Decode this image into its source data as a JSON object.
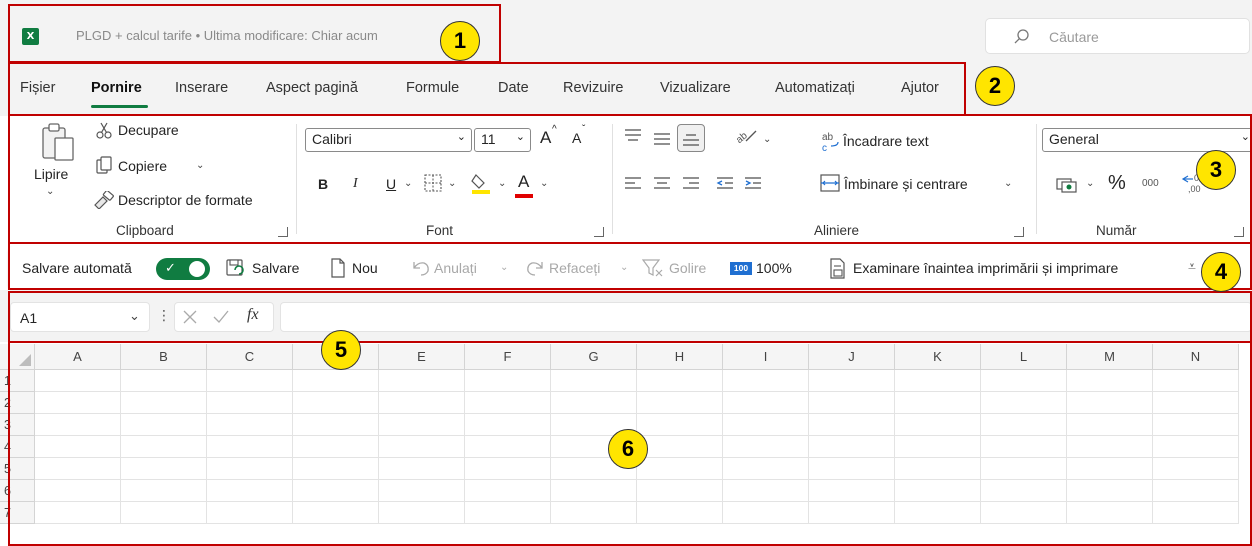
{
  "titlebar": {
    "logo_text": "X",
    "doc_title": "PLGD + calcul tarife • Ultima modificare: Chiar acum",
    "search_placeholder": "Căutare"
  },
  "menu": {
    "items": [
      "Fișier",
      "Pornire",
      "Inserare",
      "Aspect pagină",
      "Formule",
      "Date",
      "Revizuire",
      "Vizualizare",
      "Automatizați",
      "Ajutor"
    ],
    "active": "Pornire"
  },
  "ribbon": {
    "clipboard": {
      "paste": "Lipire",
      "cut": "Decupare",
      "copy": "Copiere",
      "format_painter": "Descriptor de formate",
      "label": "Clipboard"
    },
    "font": {
      "font_name": "Calibri",
      "font_size": "11",
      "bold": "B",
      "italic": "I",
      "underline": "U",
      "increase": "A",
      "decrease": "A",
      "font_color": "A",
      "label": "Font"
    },
    "alignment": {
      "wrap": "Încadrare text",
      "merge": "Îmbinare și centrare",
      "label": "Aliniere"
    },
    "number": {
      "format": "General",
      "percent": "%",
      "thousands": "000",
      "label": "Număr"
    }
  },
  "qat": {
    "autosave": "Salvare automată",
    "save": "Salvare",
    "new": "Nou",
    "undo": "Anulați",
    "redo": "Refaceți",
    "clear": "Golire",
    "zoom_icon_text": "100",
    "zoom": "100%",
    "print_preview": "Examinare înaintea imprimării și imprimare"
  },
  "formula_bar": {
    "name_box": "A1",
    "fx": "fx",
    "formula": ""
  },
  "grid": {
    "columns": [
      "A",
      "B",
      "C",
      "D",
      "E",
      "F",
      "G",
      "H",
      "I",
      "J",
      "K",
      "L",
      "M",
      "N"
    ],
    "rows": [
      "1",
      "2",
      "3",
      "4",
      "5",
      "6",
      "7"
    ]
  },
  "annotations": [
    "1",
    "2",
    "3",
    "4",
    "5",
    "6"
  ],
  "colors": {
    "accent": "#107c41",
    "annotation_border": "#c00000",
    "badge": "#ffe500"
  }
}
